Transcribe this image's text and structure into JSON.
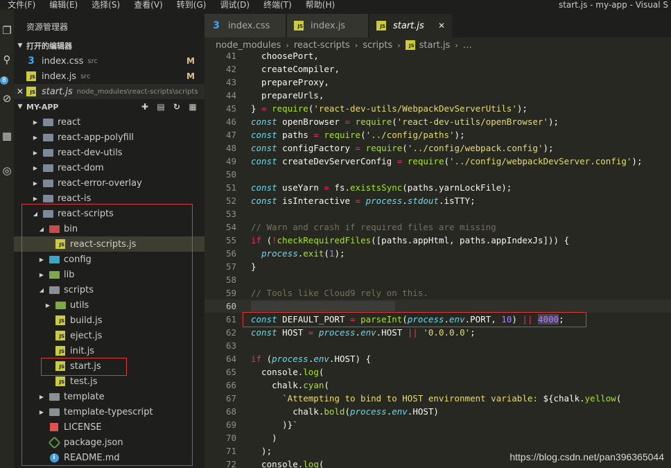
{
  "menu": [
    "文件(F)",
    "编辑(E)",
    "选择(S)",
    "查看(V)",
    "转到(G)",
    "调试(D)",
    "终端(T)",
    "帮助(H)"
  ],
  "window_title": "start.js - my-app - Visual S",
  "activity": {
    "badge": "8"
  },
  "sidebar": {
    "title": "资源管理器",
    "open_editors": {
      "header": "打开的编辑器",
      "items": [
        {
          "name": "index.css",
          "desc": "src",
          "status": "M",
          "icon": "css-icon"
        },
        {
          "name": "index.js",
          "desc": "src",
          "status": "M",
          "icon": "js-icon"
        },
        {
          "name": "start.js",
          "desc": "node_modules\\react-scripts\\scripts",
          "status": "",
          "icon": "js-icon"
        }
      ]
    },
    "project": {
      "header": "MY-APP",
      "tree": [
        {
          "name": "react",
          "kind": "folder"
        },
        {
          "name": "react-app-polyfill",
          "kind": "folder"
        },
        {
          "name": "react-dev-utils",
          "kind": "folder"
        },
        {
          "name": "react-dom",
          "kind": "folder"
        },
        {
          "name": "react-error-overlay",
          "kind": "folder"
        },
        {
          "name": "react-is",
          "kind": "folder"
        },
        {
          "name": "react-scripts",
          "kind": "folder-open"
        },
        {
          "name": "bin",
          "kind": "folder-open"
        },
        {
          "name": "react-scripts.js",
          "kind": "js"
        },
        {
          "name": "config",
          "kind": "folder"
        },
        {
          "name": "lib",
          "kind": "folder"
        },
        {
          "name": "scripts",
          "kind": "folder-open"
        },
        {
          "name": "utils",
          "kind": "folder"
        },
        {
          "name": "build.js",
          "kind": "js"
        },
        {
          "name": "eject.js",
          "kind": "js"
        },
        {
          "name": "init.js",
          "kind": "js"
        },
        {
          "name": "start.js",
          "kind": "js"
        },
        {
          "name": "test.js",
          "kind": "js"
        },
        {
          "name": "template",
          "kind": "folder"
        },
        {
          "name": "template-typescript",
          "kind": "folder"
        },
        {
          "name": "LICENSE",
          "kind": "license"
        },
        {
          "name": "package.json",
          "kind": "package"
        },
        {
          "name": "README.md",
          "kind": "info"
        }
      ]
    }
  },
  "tabs": [
    {
      "name": "index.css",
      "icon": "css-icon"
    },
    {
      "name": "index.js",
      "icon": "js-icon"
    },
    {
      "name": "start.js",
      "icon": "js-icon",
      "active": true
    }
  ],
  "breadcrumbs": [
    "node_modules",
    "react-scripts",
    "scripts",
    "start.js",
    "…"
  ],
  "code": {
    "lines": [
      {
        "n": "41",
        "tokens": [
          [
            "pl",
            "  choosePort,"
          ]
        ]
      },
      {
        "n": "42",
        "tokens": [
          [
            "pl",
            "  createCompiler,"
          ]
        ]
      },
      {
        "n": "43",
        "tokens": [
          [
            "pl",
            "  prepareProxy,"
          ]
        ]
      },
      {
        "n": "44",
        "tokens": [
          [
            "pl",
            "  prepareUrls,"
          ]
        ]
      },
      {
        "n": "45",
        "tokens": [
          [
            "pl",
            "} "
          ],
          [
            "op",
            "="
          ],
          [
            "pl",
            " "
          ],
          [
            "fn",
            "require"
          ],
          [
            "pl",
            "("
          ],
          [
            "st",
            "'react-dev-utils/WebpackDevServerUtils'"
          ],
          [
            "pl",
            ");"
          ]
        ]
      },
      {
        "n": "46",
        "tokens": [
          [
            "kw",
            "const"
          ],
          [
            "pl",
            " openBrowser "
          ],
          [
            "op",
            "="
          ],
          [
            "pl",
            " "
          ],
          [
            "fn",
            "require"
          ],
          [
            "pl",
            "("
          ],
          [
            "st",
            "'react-dev-utils/openBrowser'"
          ],
          [
            "pl",
            ");"
          ]
        ]
      },
      {
        "n": "47",
        "tokens": [
          [
            "kw",
            "const"
          ],
          [
            "pl",
            " paths "
          ],
          [
            "op",
            "="
          ],
          [
            "pl",
            " "
          ],
          [
            "fn",
            "require"
          ],
          [
            "pl",
            "("
          ],
          [
            "st",
            "'../config/paths'"
          ],
          [
            "pl",
            ");"
          ]
        ]
      },
      {
        "n": "48",
        "tokens": [
          [
            "kw",
            "const"
          ],
          [
            "pl",
            " configFactory "
          ],
          [
            "op",
            "="
          ],
          [
            "pl",
            " "
          ],
          [
            "fn",
            "require"
          ],
          [
            "pl",
            "("
          ],
          [
            "st",
            "'../config/webpack.config'"
          ],
          [
            "pl",
            ");"
          ]
        ]
      },
      {
        "n": "49",
        "tokens": [
          [
            "kw",
            "const"
          ],
          [
            "pl",
            " createDevServerConfig "
          ],
          [
            "op",
            "="
          ],
          [
            "pl",
            " "
          ],
          [
            "fn",
            "require"
          ],
          [
            "pl",
            "("
          ],
          [
            "st",
            "'../config/webpackDevServer.config'"
          ],
          [
            "pl",
            ");"
          ]
        ]
      },
      {
        "n": "50",
        "tokens": []
      },
      {
        "n": "51",
        "tokens": [
          [
            "kw",
            "const"
          ],
          [
            "pl",
            " useYarn "
          ],
          [
            "op",
            "="
          ],
          [
            "pl",
            " fs."
          ],
          [
            "fn",
            "existsSync"
          ],
          [
            "pl",
            "(paths.yarnLockFile);"
          ]
        ]
      },
      {
        "n": "52",
        "tokens": [
          [
            "kw",
            "const"
          ],
          [
            "pl",
            " isInteractive "
          ],
          [
            "op",
            "="
          ],
          [
            "pl",
            " "
          ],
          [
            "glob",
            "process"
          ],
          [
            "pl",
            "."
          ],
          [
            "glob",
            "stdout"
          ],
          [
            "pl",
            ".isTTY;"
          ]
        ]
      },
      {
        "n": "53",
        "tokens": []
      },
      {
        "n": "54",
        "tokens": [
          [
            "cm",
            "// Warn and crash if required files are missing"
          ]
        ]
      },
      {
        "n": "55",
        "tokens": [
          [
            "op",
            "if"
          ],
          [
            "pl",
            " ("
          ],
          [
            "op",
            "!"
          ],
          [
            "fn",
            "checkRequiredFiles"
          ],
          [
            "pl",
            "([paths.appHtml, paths.appIndexJs])) {"
          ]
        ]
      },
      {
        "n": "56",
        "tokens": [
          [
            "pl",
            "  "
          ],
          [
            "glob",
            "process"
          ],
          [
            "pl",
            "."
          ],
          [
            "fn",
            "exit"
          ],
          [
            "pl",
            "("
          ],
          [
            "nu",
            "1"
          ],
          [
            "pl",
            ");"
          ]
        ]
      },
      {
        "n": "57",
        "tokens": [
          [
            "pl",
            "}"
          ]
        ]
      },
      {
        "n": "58",
        "tokens": []
      },
      {
        "n": "59",
        "tokens": [
          [
            "cm",
            "// Tools like Cloud9 rely on this."
          ]
        ]
      },
      {
        "n": "60",
        "tokens": [
          [
            "blur",
            "// 端口号 ... 端口设置 ...    "
          ]
        ],
        "current": true
      },
      {
        "n": "61",
        "tokens": [
          [
            "kw",
            "const"
          ],
          [
            "pl",
            " DEFAULT_PORT "
          ],
          [
            "op",
            "="
          ],
          [
            "pl",
            " "
          ],
          [
            "fn",
            "parseInt"
          ],
          [
            "pl",
            "("
          ],
          [
            "glob",
            "process"
          ],
          [
            "pl",
            "."
          ],
          [
            "glob",
            "env"
          ],
          [
            "pl",
            ".PORT, "
          ],
          [
            "nu",
            "10"
          ],
          [
            "pl",
            ") "
          ],
          [
            "op",
            "||"
          ],
          [
            "pl",
            " "
          ],
          [
            "hlnu",
            "4000"
          ],
          [
            "pl",
            ";"
          ]
        ]
      },
      {
        "n": "62",
        "tokens": [
          [
            "kw",
            "const"
          ],
          [
            "pl",
            " HOST "
          ],
          [
            "op",
            "="
          ],
          [
            "pl",
            " "
          ],
          [
            "glob",
            "process"
          ],
          [
            "pl",
            "."
          ],
          [
            "glob",
            "env"
          ],
          [
            "pl",
            ".HOST "
          ],
          [
            "op",
            "||"
          ],
          [
            "pl",
            " "
          ],
          [
            "st",
            "'0.0.0.0'"
          ],
          [
            "pl",
            ";"
          ]
        ]
      },
      {
        "n": "63",
        "tokens": []
      },
      {
        "n": "64",
        "tokens": [
          [
            "op",
            "if"
          ],
          [
            "pl",
            " ("
          ],
          [
            "glob",
            "process"
          ],
          [
            "pl",
            "."
          ],
          [
            "glob",
            "env"
          ],
          [
            "pl",
            ".HOST) {"
          ]
        ]
      },
      {
        "n": "65",
        "tokens": [
          [
            "pl",
            "  console."
          ],
          [
            "fn",
            "log"
          ],
          [
            "pl",
            "("
          ]
        ]
      },
      {
        "n": "66",
        "tokens": [
          [
            "pl",
            "    chalk."
          ],
          [
            "fn",
            "cyan"
          ],
          [
            "pl",
            "("
          ]
        ]
      },
      {
        "n": "67",
        "tokens": [
          [
            "st",
            "      `Attempting to bind to HOST environment variable: "
          ],
          [
            "pl",
            "${chalk."
          ],
          [
            "fn",
            "yellow"
          ],
          [
            "pl",
            "("
          ]
        ]
      },
      {
        "n": "68",
        "tokens": [
          [
            "pl",
            "        chalk."
          ],
          [
            "fn",
            "bold"
          ],
          [
            "pl",
            "("
          ],
          [
            "glob",
            "process"
          ],
          [
            "pl",
            "."
          ],
          [
            "glob",
            "env"
          ],
          [
            "pl",
            ".HOST)"
          ]
        ]
      },
      {
        "n": "69",
        "tokens": [
          [
            "pl",
            "      )}"
          ],
          [
            "st",
            "`"
          ]
        ]
      },
      {
        "n": "70",
        "tokens": [
          [
            "pl",
            "    )"
          ]
        ]
      },
      {
        "n": "71",
        "tokens": [
          [
            "pl",
            "  );"
          ]
        ]
      },
      {
        "n": "72",
        "tokens": [
          [
            "pl",
            "  console."
          ],
          [
            "fn",
            "log"
          ],
          [
            "pl",
            "("
          ]
        ]
      }
    ]
  },
  "watermark": "https://blog.csdn.net/pan396365044",
  "colors": {
    "highlight_box": "#e23a3a",
    "editor_bg": "#272822",
    "sidebar_bg": "#1e1f1c"
  }
}
